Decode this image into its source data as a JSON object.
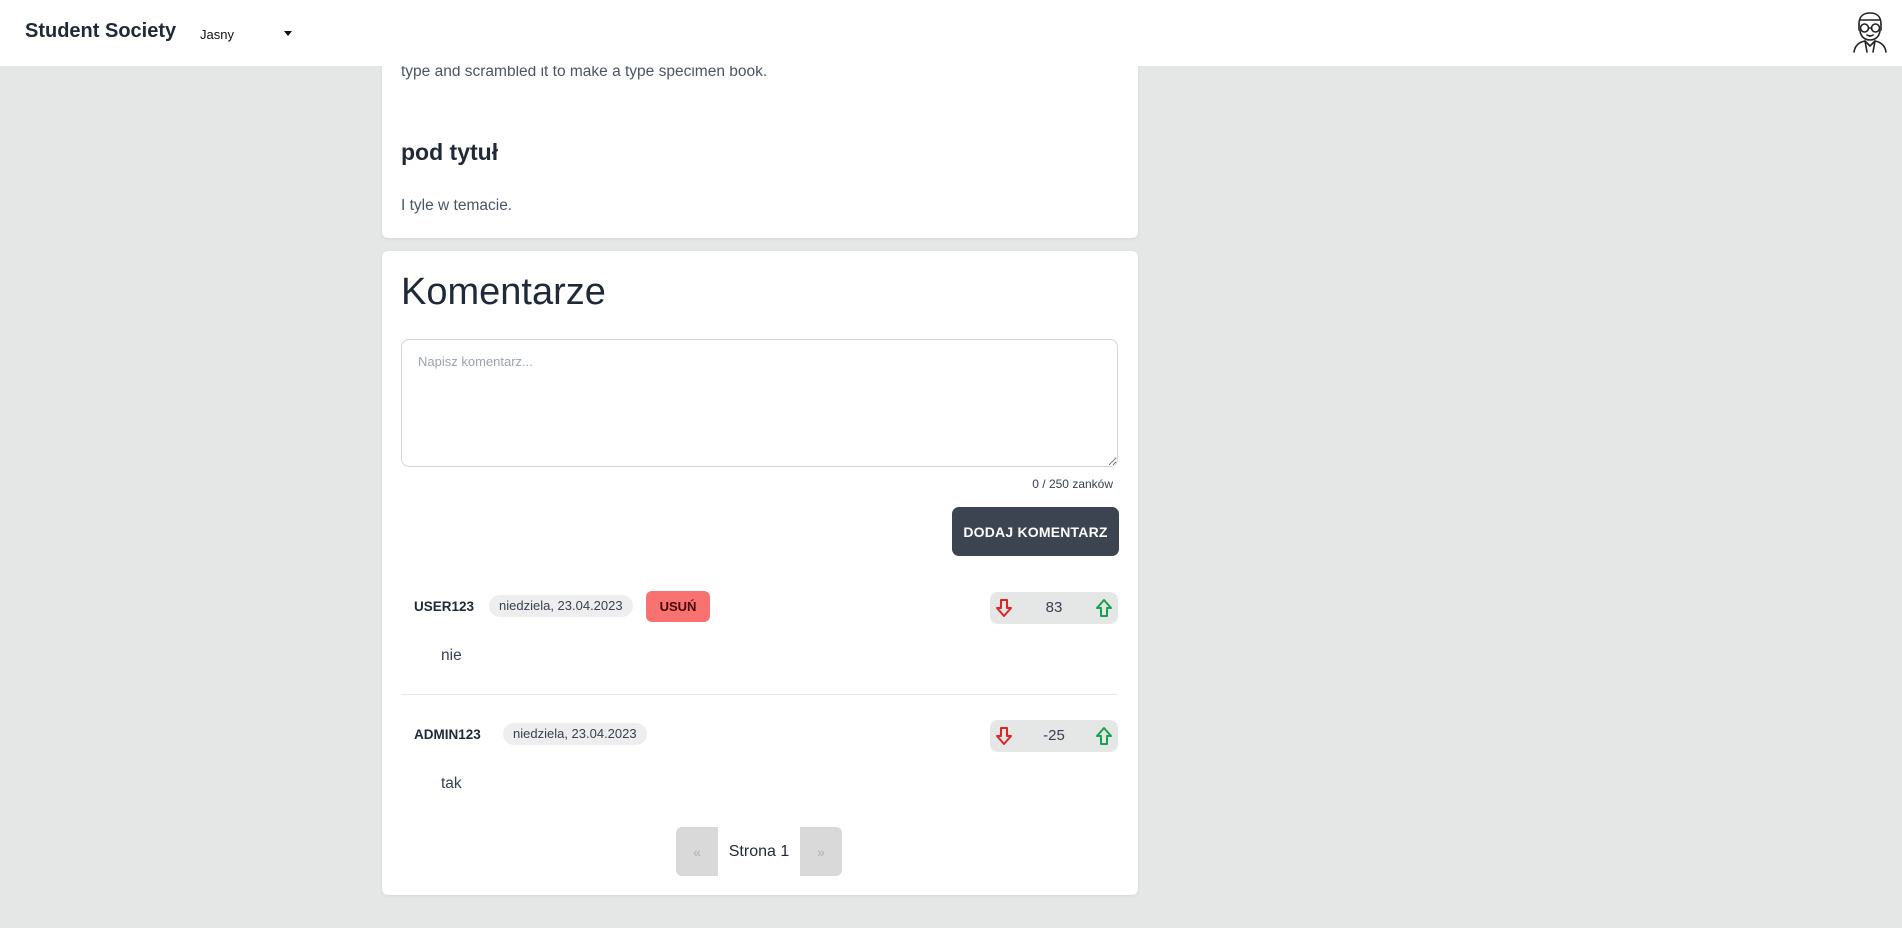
{
  "navbar": {
    "brand": "Student Society",
    "theme_selected": "Jasny",
    "avatar_icon": "nerd-avatar-icon"
  },
  "article": {
    "text_tail": "type and scrambled it to make a type specimen book.",
    "subtitle": "pod tytuł",
    "closing_text": "I tyle w temacie."
  },
  "comments": {
    "title": "Komentarze",
    "placeholder": "Napisz komentarz...",
    "value": "",
    "counter": "0 / 250 zanków",
    "add_button": "DODAJ KOMENTARZ",
    "items": [
      {
        "author": "USER123",
        "date": "niedziela, 23.04.2023",
        "delete_label": "USUŃ",
        "score": "83",
        "text": "nie"
      },
      {
        "author": "ADMIN123",
        "date": "niedziela, 23.04.2023",
        "score": "-25",
        "text": "tak"
      }
    ]
  },
  "pagination": {
    "prev": "«",
    "current": "Strona 1",
    "next": "»"
  },
  "colors": {
    "background": "#e5e6e6",
    "primary_button": "#3d4451",
    "danger": "#f87272",
    "downvote": "#dc2626",
    "upvote": "#16a34a"
  }
}
